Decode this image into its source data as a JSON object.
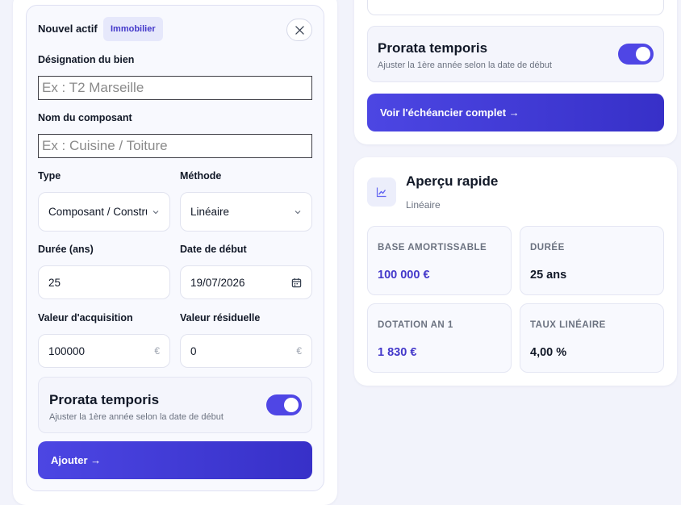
{
  "form": {
    "title": "Nouvel actif",
    "badge": "Immobilier",
    "designation": {
      "label": "Désignation du bien",
      "placeholder": "Ex : T2 Marseille",
      "value": ""
    },
    "component": {
      "label": "Nom du composant",
      "placeholder": "Ex : Cuisine / Toiture",
      "value": ""
    },
    "type": {
      "label": "Type",
      "selected": "Composant / Construction"
    },
    "method": {
      "label": "Méthode",
      "selected": "Linéaire"
    },
    "duration": {
      "label": "Durée (ans)",
      "value": "25"
    },
    "start_date": {
      "label": "Date de début",
      "value": "19/07/2026"
    },
    "acquisition": {
      "label": "Valeur d'acquisition",
      "value": "100000",
      "suffix": "€"
    },
    "residual": {
      "label": "Valeur résiduelle",
      "value": "0",
      "suffix": "€"
    },
    "prorata": {
      "title": "Prorata temporis",
      "subtitle": "Ajuster la 1ère année selon la date de début",
      "enabled": true
    },
    "submit_label": "Ajouter →"
  },
  "results": {
    "prorata": {
      "title": "Prorata temporis",
      "subtitle": "Ajuster la 1ère année selon la date de début",
      "enabled": true
    },
    "schedule_label": "Voir l'échéancier complet →"
  },
  "preview": {
    "title": "Aperçu rapide",
    "subtitle": "Linéaire",
    "stats": [
      {
        "label": "BASE AMORTISSABLE",
        "value": "100 000 €"
      },
      {
        "label": "DURÉE",
        "value": "25 ans"
      },
      {
        "label": "DOTATION AN 1",
        "value": "1 830 €"
      },
      {
        "label": "TAUX LINÉAIRE",
        "value": "4,00 %"
      }
    ]
  },
  "colors": {
    "accent": "#4f46e5",
    "accent_dark": "#3730c8",
    "background": "#f2f3fb"
  },
  "icons": [
    "close-icon",
    "chevron-down-icon",
    "calendar-icon",
    "chart-icon"
  ]
}
